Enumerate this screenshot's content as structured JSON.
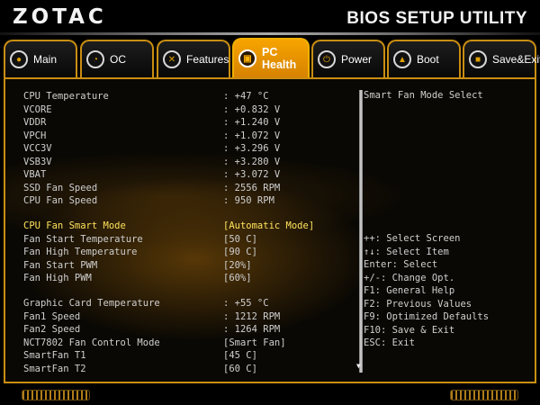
{
  "header": {
    "logo": "ZOTAC",
    "utility_title": "BIOS SETUP UTILITY"
  },
  "tabs": [
    {
      "label": "Main",
      "icon": "disc-icon",
      "active": false
    },
    {
      "label": "OC",
      "icon": "gauge-icon",
      "active": false
    },
    {
      "label": "Features",
      "icon": "tools-icon",
      "active": false
    },
    {
      "label": "PC Health",
      "icon": "chip-icon",
      "active": true
    },
    {
      "label": "Power",
      "icon": "power-icon",
      "active": false
    },
    {
      "label": "Boot",
      "icon": "lock-icon",
      "active": false
    },
    {
      "label": "Save&Exit",
      "icon": "save-icon",
      "active": false
    }
  ],
  "health": [
    {
      "label": "CPU Temperature",
      "value": ": +47 °C"
    },
    {
      "label": "VCORE",
      "value": ": +0.832 V"
    },
    {
      "label": "VDDR",
      "value": ": +1.240 V"
    },
    {
      "label": "VPCH",
      "value": ": +1.072 V"
    },
    {
      "label": "VCC3V",
      "value": ": +3.296 V"
    },
    {
      "label": "VSB3V",
      "value": ": +3.280 V"
    },
    {
      "label": "VBAT",
      "value": ": +3.072 V"
    },
    {
      "label": "SSD Fan Speed",
      "value": ": 2556 RPM"
    },
    {
      "label": "CPU Fan Speed",
      "value": ": 950 RPM"
    }
  ],
  "cpu_fan": [
    {
      "label": "CPU Fan Smart Mode",
      "value": "[Automatic Mode]",
      "selected": true
    },
    {
      "label": "Fan Start Temperature",
      "value": "[50 C]"
    },
    {
      "label": "Fan High Temperature",
      "value": "[90 C]"
    },
    {
      "label": "Fan Start PWM",
      "value": "[20%]"
    },
    {
      "label": "Fan High PWM",
      "value": "[60%]"
    }
  ],
  "system_fan": [
    {
      "label": "Graphic Card Temperature",
      "value": ": +55 °C"
    },
    {
      "label": "Fan1 Speed",
      "value": ": 1212 RPM"
    },
    {
      "label": "Fan2 Speed",
      "value": ": 1264 RPM"
    },
    {
      "label": "NCT7802 Fan Control Mode",
      "value": "[Smart Fan]"
    },
    {
      "label": "SmartFan T1",
      "value": "[45 C]"
    },
    {
      "label": "SmartFan T2",
      "value": "[60 C]"
    }
  ],
  "help_text": "Smart Fan  Mode Select",
  "keys": [
    "++: Select Screen",
    "↑↓: Select Item",
    "Enter: Select",
    "+/-: Change Opt.",
    "F1: General Help",
    "F2: Previous Values",
    "F9: Optimized Defaults",
    "F10: Save & Exit",
    "ESC: Exit"
  ],
  "colors": {
    "accent": "#c98e12",
    "active_tab": "#f7a400",
    "selected_text": "#ffe35c",
    "text": "#cfcfcf"
  }
}
